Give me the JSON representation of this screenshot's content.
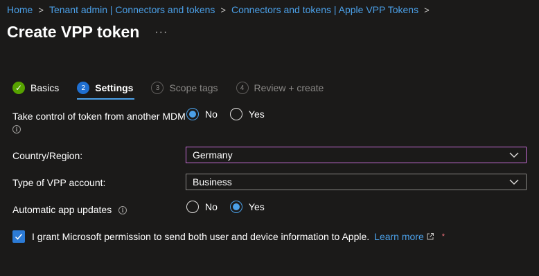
{
  "breadcrumb": {
    "items": [
      "Home",
      "Tenant admin | Connectors and tokens",
      "Connectors and tokens | Apple VPP Tokens"
    ],
    "separator": ">"
  },
  "page": {
    "title": "Create VPP token",
    "more": "···"
  },
  "wizard": {
    "steps": [
      {
        "number": "✓",
        "label": "Basics",
        "state": "done"
      },
      {
        "number": "2",
        "label": "Settings",
        "state": "active"
      },
      {
        "number": "3",
        "label": "Scope tags",
        "state": "future"
      },
      {
        "number": "4",
        "label": "Review + create",
        "state": "future"
      }
    ]
  },
  "form": {
    "take_control": {
      "label": "Take control of token from another MDM",
      "options": [
        "No",
        "Yes"
      ],
      "selected": "No"
    },
    "country": {
      "label": "Country/Region:",
      "value": "Germany"
    },
    "account_type": {
      "label": "Type of VPP account:",
      "value": "Business"
    },
    "auto_updates": {
      "label": "Automatic app updates",
      "options": [
        "No",
        "Yes"
      ],
      "selected": "Yes"
    },
    "consent": {
      "text": "I grant Microsoft permission to send both user and device information to Apple.",
      "link": "Learn more",
      "required_mark": "*",
      "checked": true
    }
  },
  "colors": {
    "accent": "#4ba0e8",
    "done": "#57a300",
    "focus": "#c86dd7",
    "background": "#1b1a19"
  }
}
